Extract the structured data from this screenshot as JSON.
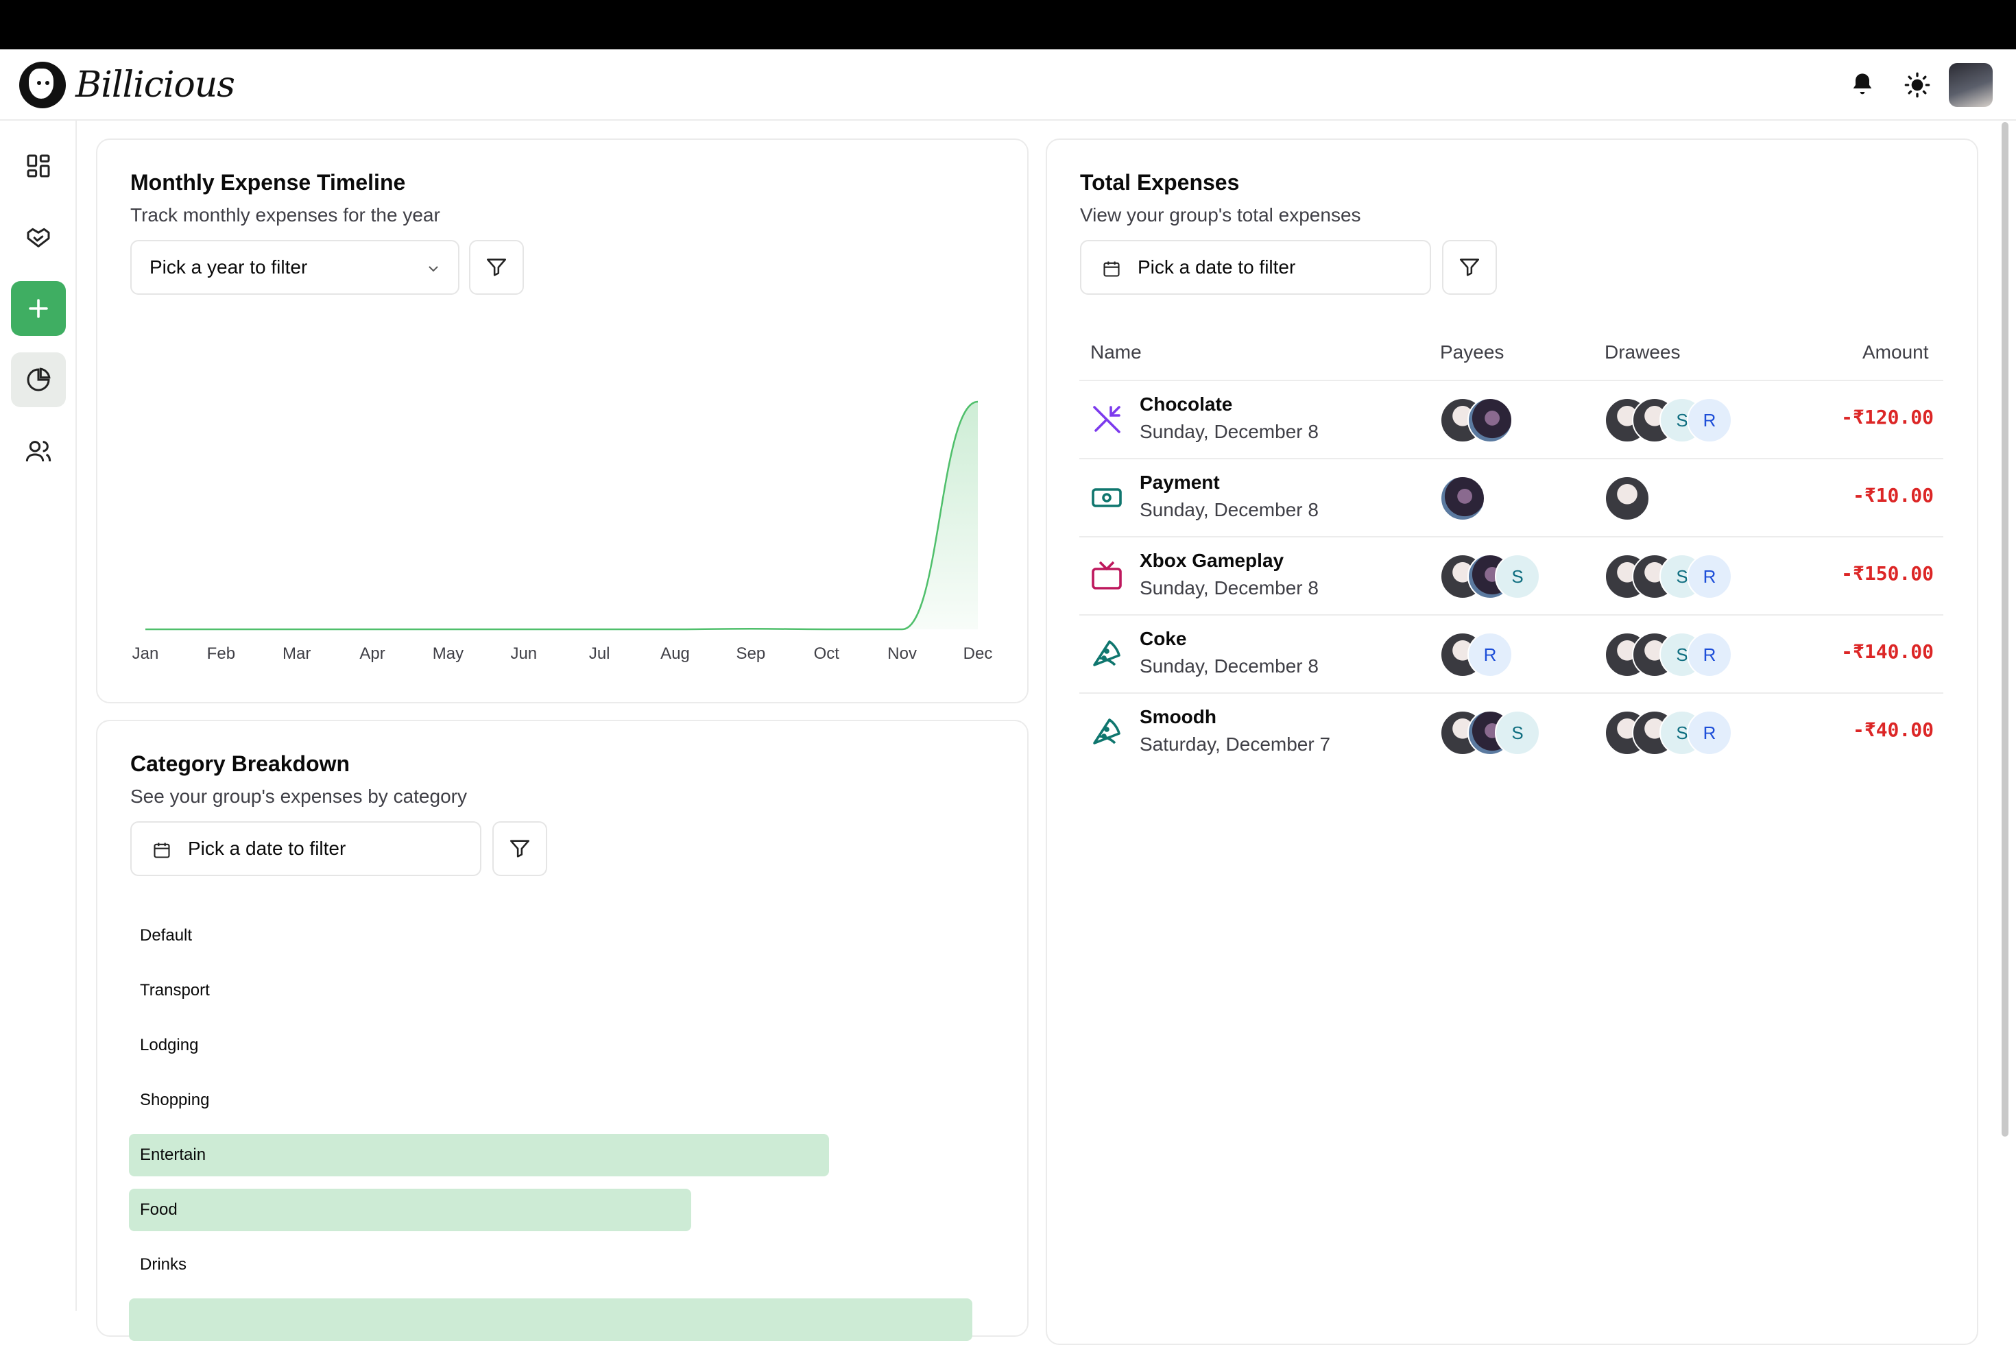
{
  "app": {
    "brand": "Billicious"
  },
  "header": {
    "icons": [
      "bell-icon",
      "sun-icon",
      "user-avatar"
    ]
  },
  "sidebar": {
    "items": [
      "dashboard-icon",
      "handshake-icon",
      "plus-icon",
      "pie-chart-icon",
      "users-icon"
    ]
  },
  "timeline": {
    "title": "Monthly Expense Timeline",
    "subtitle": "Track monthly expenses for the year",
    "year_placeholder": "Pick a year to filter",
    "chart_data": {
      "type": "area",
      "x": [
        "Jan",
        "Feb",
        "Mar",
        "Apr",
        "May",
        "Jun",
        "Jul",
        "Aug",
        "Sep",
        "Oct",
        "Nov",
        "Dec"
      ],
      "y": [
        0,
        0,
        0,
        0,
        0,
        0,
        0,
        0,
        1,
        0,
        0,
        460
      ],
      "color": "#4fbf6b"
    }
  },
  "breakdown": {
    "title": "Category Breakdown",
    "subtitle": "See your group's expenses by category",
    "date_placeholder": "Pick a date to filter",
    "categories": [
      {
        "label": "Default",
        "fraction": 0
      },
      {
        "label": "Transport",
        "fraction": 0
      },
      {
        "label": "Lodging",
        "fraction": 0
      },
      {
        "label": "Shopping",
        "fraction": 0
      },
      {
        "label": "Entertain",
        "fraction": 0.83
      },
      {
        "label": "Food",
        "fraction": 0.667
      },
      {
        "label": "Drinks",
        "fraction": 0
      },
      {
        "label": "",
        "fraction": 1.0
      }
    ],
    "bar_color": "#cdebd5"
  },
  "total": {
    "title": "Total Expenses",
    "subtitle": "View your group's total expenses",
    "date_placeholder": "Pick a date to filter",
    "columns": {
      "name": "Name",
      "payees": "Payees",
      "drawees": "Drawees",
      "amount": "Amount"
    },
    "rows": [
      {
        "name": "Chocolate",
        "date": "Sunday, December 8",
        "amount": "-₹120.00",
        "icon": "utensils-crossed-icon"
      },
      {
        "name": "Payment",
        "date": "Sunday, December 8",
        "amount": "-₹10.00",
        "icon": "banknote-icon"
      },
      {
        "name": "Xbox Gameplay",
        "date": "Sunday, December 8",
        "amount": "-₹150.00",
        "icon": "tv-icon"
      },
      {
        "name": "Coke",
        "date": "Sunday, December 8",
        "amount": "-₹140.00",
        "icon": "pizza-icon"
      },
      {
        "name": "Smoodh",
        "date": "Saturday, December 7",
        "amount": "-₹40.00",
        "icon": "pizza-icon"
      }
    ],
    "avatar_letters": {
      "s": "S",
      "r": "R"
    }
  }
}
